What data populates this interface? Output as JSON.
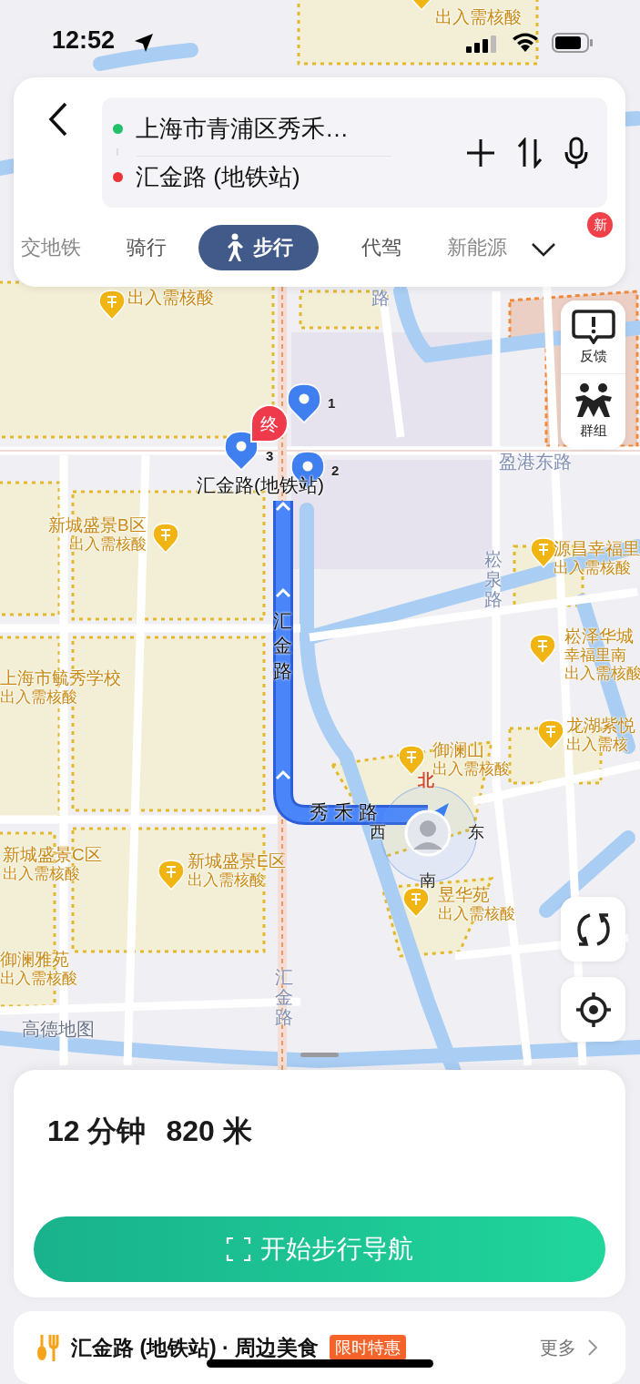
{
  "status_bar": {
    "time": "12:52"
  },
  "route_panel": {
    "origin": "上海市青浦区秀禾…",
    "destination": "汇金路 (地铁站)",
    "modes": [
      {
        "label": "交地铁",
        "selected": false
      },
      {
        "label": "骑行",
        "selected": false
      },
      {
        "label": "步行",
        "selected": true
      },
      {
        "label": "代驾",
        "selected": false
      },
      {
        "label": "新能源",
        "selected": false
      }
    ],
    "more_badge": "新"
  },
  "map": {
    "labels": [
      {
        "kind": "poi",
        "lines": [
          "出入需核酸"
        ]
      },
      {
        "kind": "poi",
        "lines": [
          "出入需核酸"
        ]
      },
      {
        "kind": "road-vertical",
        "text": "路"
      },
      {
        "kind": "marker",
        "text": "1"
      },
      {
        "kind": "marker",
        "text": "3"
      },
      {
        "kind": "marker",
        "text": "2"
      },
      {
        "kind": "end-marker",
        "text": "终"
      },
      {
        "kind": "place",
        "text": "汇金路(地铁站)"
      },
      {
        "kind": "road",
        "text": "盈港东路"
      },
      {
        "kind": "poi-left",
        "lines": [
          "新城盛景B区",
          "出入需核酸"
        ]
      },
      {
        "kind": "road-vertical",
        "text": "崧泉路"
      },
      {
        "kind": "poi",
        "lines": [
          "源昌幸福里",
          "出入需核酸"
        ]
      },
      {
        "kind": "poi",
        "lines": [
          "崧泽华城",
          "幸福里南",
          "出入需核酸"
        ]
      },
      {
        "kind": "area",
        "lines": [
          "上海市毓秀学校",
          "出入需核酸"
        ]
      },
      {
        "kind": "route-vertical",
        "text": "汇金路"
      },
      {
        "kind": "poi",
        "lines": [
          "龙湖紫悦",
          "出入需核"
        ]
      },
      {
        "kind": "poi",
        "lines": [
          "御澜山",
          "出入需核酸"
        ]
      },
      {
        "kind": "route",
        "text": "秀 禾 路"
      },
      {
        "kind": "area",
        "lines": [
          "新城盛景C区",
          "出入需核酸"
        ]
      },
      {
        "kind": "poi",
        "lines": [
          "新城盛景E区",
          "出入需核酸"
        ]
      },
      {
        "kind": "poi",
        "lines": [
          "昱华苑",
          "出入需核酸"
        ]
      },
      {
        "kind": "area",
        "lines": [
          "御澜雅苑",
          "出入需核酸"
        ]
      },
      {
        "kind": "road-vertical",
        "text": "汇金路"
      },
      {
        "kind": "compass",
        "text": "北"
      },
      {
        "kind": "compass",
        "text": "西"
      },
      {
        "kind": "compass",
        "text": "东"
      },
      {
        "kind": "compass",
        "text": "南"
      }
    ],
    "logo": "高德地图",
    "side_buttons": [
      {
        "label": "反馈"
      },
      {
        "label": "群组"
      }
    ]
  },
  "summary": {
    "duration": "12 分钟",
    "distance": "820 米",
    "start_button": "开始步行导航"
  },
  "nearby": {
    "title": "汇金路 (地铁站) · 周边美食",
    "badge": "限时特惠",
    "more": "更多"
  }
}
